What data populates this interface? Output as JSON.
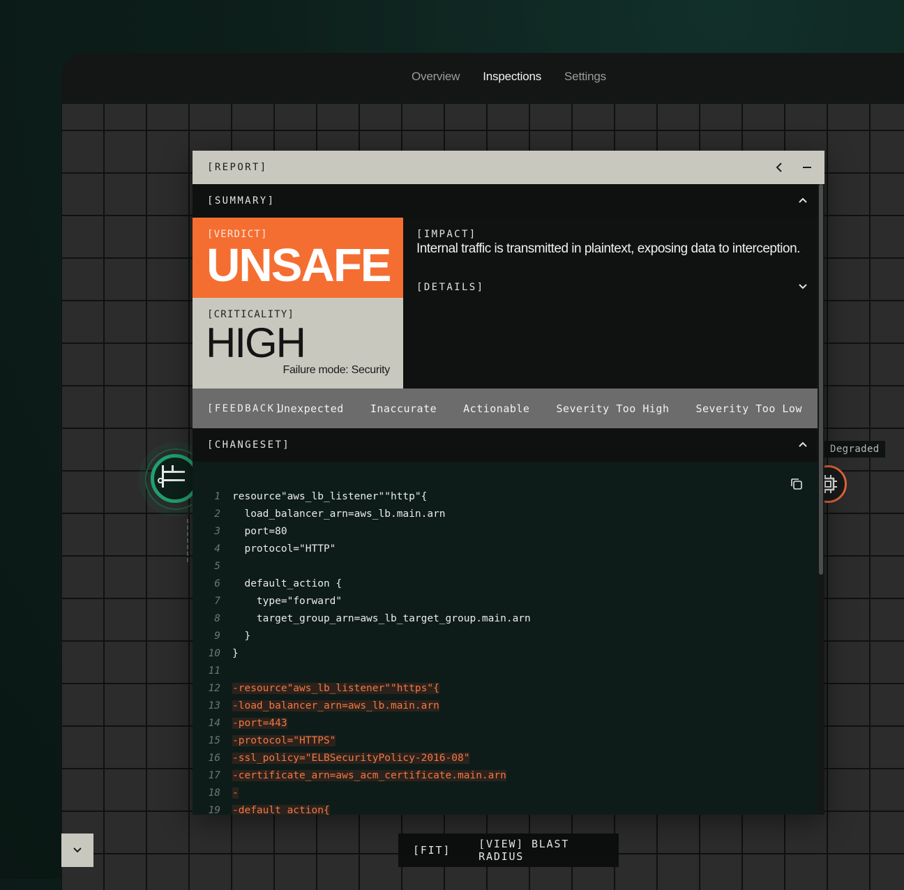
{
  "nav": {
    "items": [
      "Overview",
      "Inspections",
      "Settings"
    ],
    "active": "Inspections"
  },
  "graph": {
    "degraded_label": "Degraded"
  },
  "bottom": {
    "fit": "[FIT]",
    "view": "[VIEW] BLAST RADIUS"
  },
  "report": {
    "title": "[REPORT]",
    "summary": {
      "label": "[SUMMARY]",
      "verdict_tag": "[VERDICT]",
      "verdict": "UNSAFE",
      "criticality_tag": "[CRITICALITY]",
      "criticality": "HIGH",
      "failure_mode": "Failure mode: Security",
      "impact_tag": "[IMPACT]",
      "impact": "Internal traffic is transmitted in plaintext, exposing data to interception.",
      "details_tag": "[DETAILS]"
    },
    "feedback": {
      "label": "[FEEDBACK]",
      "options": [
        "Unexpected",
        "Inaccurate",
        "Actionable",
        "Severity Too High",
        "Severity Too Low"
      ]
    },
    "changeset": {
      "label": "[CHANGESET]",
      "lines": [
        {
          "n": "1",
          "text": "resource\"aws_lb_listener\"\"http\"{",
          "del": false
        },
        {
          "n": "2",
          "text": "  load_balancer_arn=aws_lb.main.arn",
          "del": false
        },
        {
          "n": "3",
          "text": "  port=80",
          "del": false
        },
        {
          "n": "4",
          "text": "  protocol=\"HTTP\"",
          "del": false
        },
        {
          "n": "5",
          "text": "",
          "del": false
        },
        {
          "n": "6",
          "text": "  default_action {",
          "del": false
        },
        {
          "n": "7",
          "text": "    type=\"forward\"",
          "del": false
        },
        {
          "n": "8",
          "text": "    target_group_arn=aws_lb_target_group.main.arn",
          "del": false
        },
        {
          "n": "9",
          "text": "  }",
          "del": false
        },
        {
          "n": "10",
          "text": "}",
          "del": false
        },
        {
          "n": "11",
          "text": "",
          "del": false
        },
        {
          "n": "12",
          "text": "-resource\"aws_lb_listener\"\"https\"{",
          "del": true
        },
        {
          "n": "13",
          "text": "-load_balancer_arn=aws_lb.main.arn",
          "del": true
        },
        {
          "n": "14",
          "text": "-port=443",
          "del": true
        },
        {
          "n": "15",
          "text": "-protocol=\"HTTPS\"",
          "del": true
        },
        {
          "n": "16",
          "text": "-ssl_policy=\"ELBSecurityPolicy-2016-08\"",
          "del": true
        },
        {
          "n": "17",
          "text": "-certificate_arn=aws_acm_certificate.main.arn",
          "del": true
        },
        {
          "n": "18",
          "text": "-",
          "del": true
        },
        {
          "n": "19",
          "text": "-default_action{",
          "del": true
        }
      ]
    }
  },
  "colors": {
    "verdict": "#f56e31",
    "criticality": "#c9c8bf",
    "healthy_node": "#1fa170",
    "degraded_node": "#e4643a",
    "removed_code": "#f07843"
  }
}
